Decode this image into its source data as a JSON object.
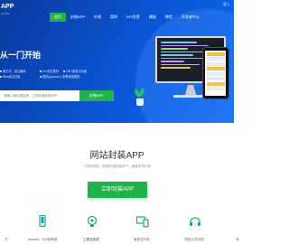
{
  "topbar": {
    "logo": "APP",
    "logo_sub": "pp.com",
    "login": "登入"
  },
  "nav": {
    "items": [
      {
        "label": "首页",
        "active": true
      },
      {
        "label": "封装APP",
        "active": false
      },
      {
        "label": "价格",
        "active": false
      },
      {
        "label": "案例",
        "active": false
      },
      {
        "label": "IOS免签",
        "active": false
      },
      {
        "label": "模板",
        "active": false
      },
      {
        "label": "教程",
        "active": false
      },
      {
        "label": "开发者中心",
        "active": false
      }
    ]
  },
  "hero": {
    "title": "从一门开始",
    "features": [
      "第五代，混合编译",
      "10+原生模块",
      "100+模板与功能",
      "Web原生封装",
      "提供Appstore上架等增值服务"
    ]
  },
  "search": {
    "placeholder": "请输入网址或名称，立刻封装你的APP",
    "button_label": "封装APP"
  },
  "main": {
    "title": "网站封装APP",
    "subtitle": "门学在线制，免费在线封装APP，速度发布代劳",
    "cta_label": "立即封装APP"
  },
  "bottom_features": [
    {
      "icon": "android-ios-icon",
      "label": "Android、iOS双系统"
    },
    {
      "icon": "bulb-icon",
      "label": "主题智能框"
    },
    {
      "icon": "devices-icon",
      "label": "免签名代劳"
    },
    {
      "icon": "headset-icon",
      "label": "热线人员支持"
    }
  ],
  "colors": {
    "brand_blue": "#0b56d6",
    "accent_green": "#21b34a"
  }
}
